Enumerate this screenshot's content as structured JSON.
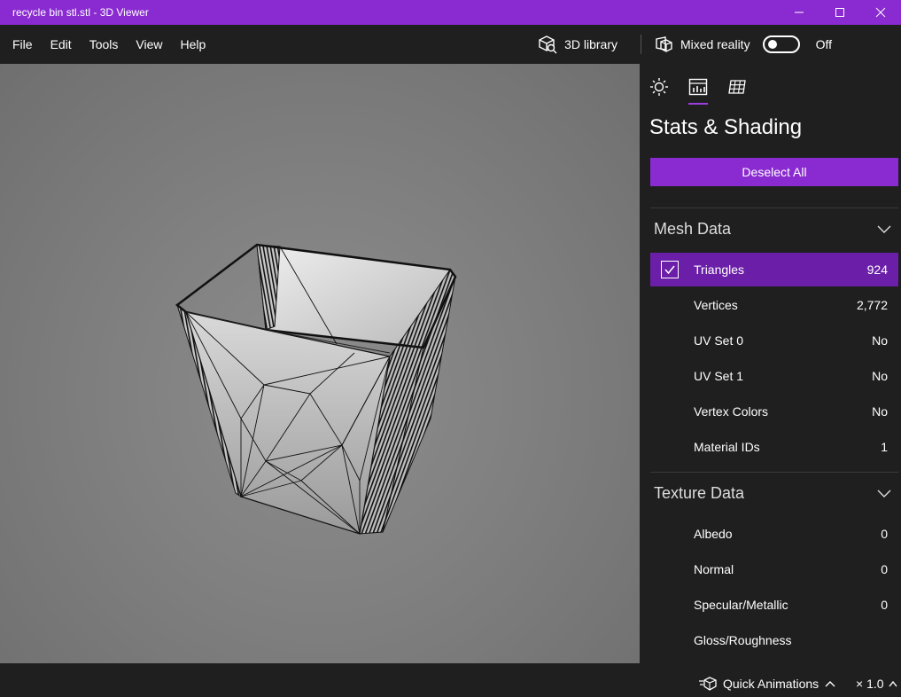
{
  "window": {
    "title": "recycle bin stl.stl - 3D Viewer"
  },
  "menu": {
    "items": [
      "File",
      "Edit",
      "Tools",
      "View",
      "Help"
    ]
  },
  "toolbar": {
    "library_label": "3D library",
    "mixed_reality_label": "Mixed reality",
    "toggle_state": "Off"
  },
  "panel": {
    "tabs": [
      "lighting-tab",
      "stats-shading-tab",
      "grid-tab"
    ],
    "active_tab": "stats-shading-tab",
    "title": "Stats & Shading",
    "deselect_label": "Deselect All",
    "mesh_section": {
      "label": "Mesh Data",
      "rows": [
        {
          "name": "Triangles",
          "value": "924",
          "selected": true
        },
        {
          "name": "Vertices",
          "value": "2,772"
        },
        {
          "name": "UV Set 0",
          "value": "No"
        },
        {
          "name": "UV Set 1",
          "value": "No"
        },
        {
          "name": "Vertex Colors",
          "value": "No"
        },
        {
          "name": "Material IDs",
          "value": "1"
        }
      ]
    },
    "texture_section": {
      "label": "Texture Data",
      "rows": [
        {
          "name": "Albedo",
          "value": "0"
        },
        {
          "name": "Normal",
          "value": "0"
        },
        {
          "name": "Specular/Metallic",
          "value": "0"
        },
        {
          "name": "Gloss/Roughness",
          "value": ""
        }
      ]
    }
  },
  "status": {
    "quick_animations_label": "Quick Animations",
    "speed_label": "× 1.0"
  },
  "colors": {
    "accent": "#8a2bd1",
    "selected_row": "#6b1fa8",
    "background": "#1f1f1f",
    "viewport": "#808080"
  }
}
